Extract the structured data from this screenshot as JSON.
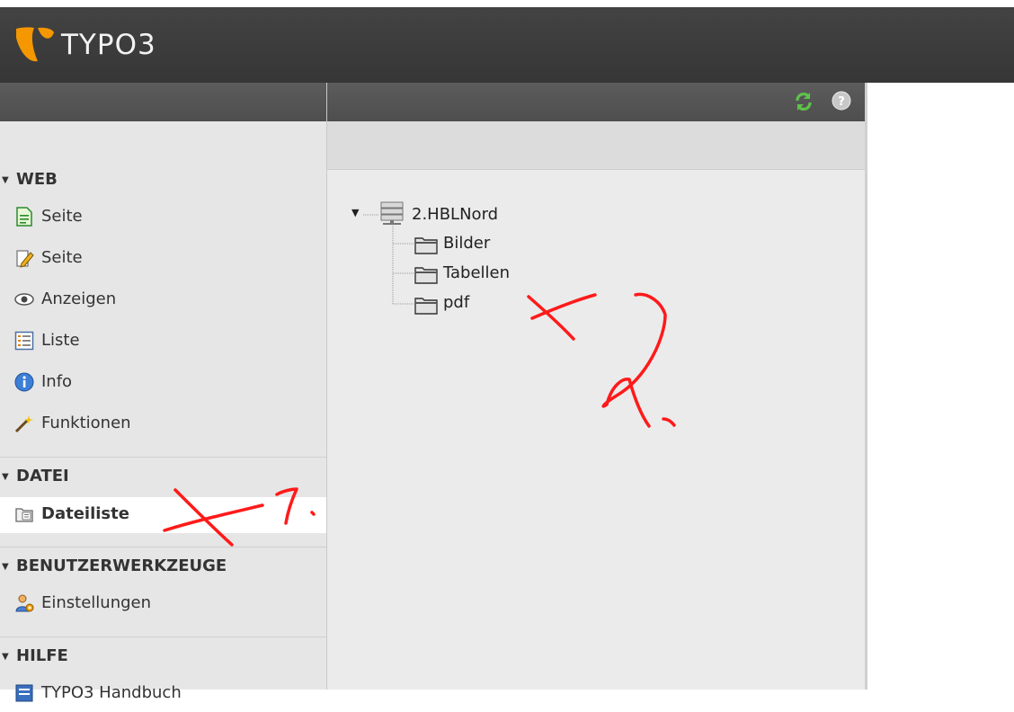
{
  "app": {
    "brand": "TYPO3"
  },
  "icons": {
    "logo": "typo3-logo-icon",
    "refresh": "refresh-icon",
    "help": "help-icon"
  },
  "colors": {
    "topbar": "#3c3c3c",
    "brand_accent": "#f49700",
    "annotation": "#ff0000"
  },
  "modules": {
    "web": {
      "title": "WEB",
      "items": [
        {
          "label": "Seite",
          "icon": "page-icon"
        },
        {
          "label": "Seite",
          "icon": "page-edit-icon"
        },
        {
          "label": "Anzeigen",
          "icon": "eye-icon"
        },
        {
          "label": "Liste",
          "icon": "list-icon"
        },
        {
          "label": "Info",
          "icon": "info-icon"
        },
        {
          "label": "Funktionen",
          "icon": "wand-icon"
        }
      ]
    },
    "datei": {
      "title": "DATEI",
      "items": [
        {
          "label": "Dateiliste",
          "icon": "filelist-icon",
          "active": true
        }
      ]
    },
    "benutzer": {
      "title": "BENUTZERWERKZEUGE",
      "items": [
        {
          "label": "Einstellungen",
          "icon": "user-settings-icon"
        }
      ]
    },
    "hilfe": {
      "title": "HILFE",
      "items": [
        {
          "label": "TYPO3 Handbuch",
          "icon": "manual-icon"
        }
      ]
    }
  },
  "tree": {
    "root": {
      "label": "2.HBLNord",
      "icon": "storage-icon",
      "expanded": true
    },
    "children": [
      {
        "label": "Bilder",
        "icon": "folder-icon"
      },
      {
        "label": "Tabellen",
        "icon": "folder-icon"
      },
      {
        "label": "pdf",
        "icon": "folder-icon"
      }
    ]
  }
}
